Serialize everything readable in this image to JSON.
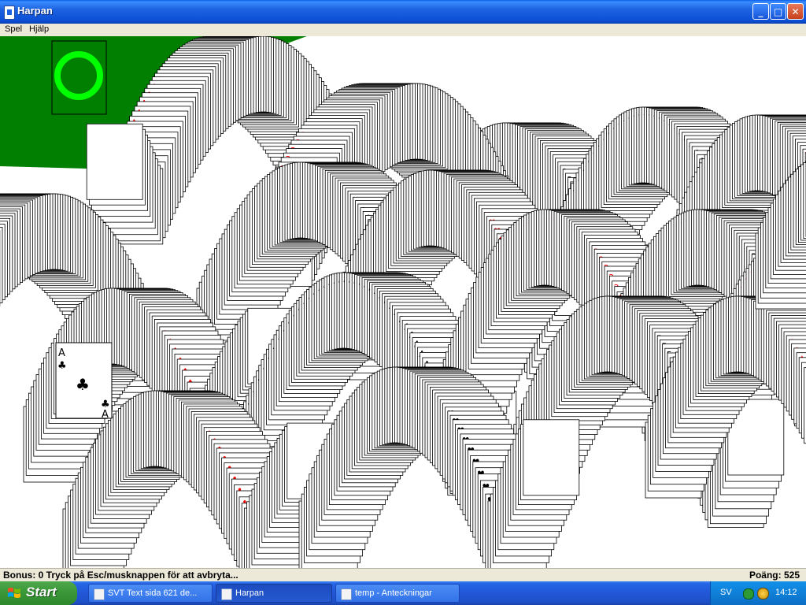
{
  "window": {
    "title": "Harpan",
    "controls": {
      "minimize": "_",
      "maximize": "□",
      "close": "✕"
    }
  },
  "menu": {
    "items": [
      "Spel",
      "Hjälp"
    ]
  },
  "game": {
    "felt_color": "#007f00",
    "placeholder_ring_color": "#00ff00",
    "red_suit_color": "#ff0000",
    "black_suit_color": "#000000",
    "visible_glyphs": [
      "A",
      "2",
      "3",
      "4",
      "5",
      "♣",
      "♥",
      "♠",
      "♦"
    ],
    "highlighted_card": {
      "rank": "A",
      "suit": "♣"
    }
  },
  "status": {
    "left": "Bonus: 0  Tryck på Esc/musknappen för att avbryta...",
    "right": "Poäng: 525"
  },
  "taskbar": {
    "start_label": "Start",
    "tasks": [
      {
        "label": "SVT Text sida 621 de...",
        "active": false
      },
      {
        "label": "Harpan",
        "active": true
      },
      {
        "label": "temp - Anteckningar",
        "active": false
      }
    ],
    "tray": {
      "language": "SV",
      "time": "14:12"
    }
  }
}
